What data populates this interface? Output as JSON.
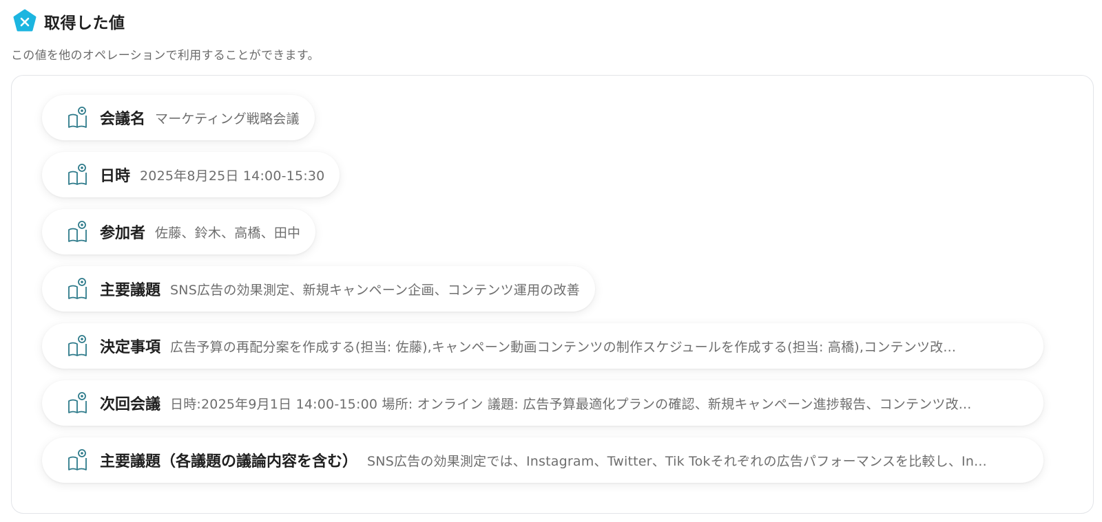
{
  "header": {
    "title": "取得した値",
    "description": "この値を他のオペレーションで利用することができます。",
    "icon": "yoom-logo-icon",
    "accent_color": "#1cb5e0"
  },
  "fields": [
    {
      "label": "会議名",
      "value": "マーケティング戦略会議"
    },
    {
      "label": "日時",
      "value": "2025年8月25日 14:00-15:30"
    },
    {
      "label": "参加者",
      "value": "佐藤、鈴木、高橋、田中"
    },
    {
      "label": "主要議題",
      "value": "SNS広告の効果測定、新規キャンペーン企画、コンテンツ運用の改善"
    },
    {
      "label": "決定事項",
      "value": "広告予算の再配分案を作成する(担当: 佐藤),キャンペーン動画コンテンツの制作スケジュールを作成する(担当: 高橋),コンテンツ改..."
    },
    {
      "label": "次回会議",
      "value": "日時:2025年9月1日 14:00-15:00 場所: オンライン 議題: 広告予算最適化プランの確認、新規キャンペーン進捗報告、コンテンツ改..."
    },
    {
      "label": "主要議題（各議題の議論内容を含む）",
      "value": "SNS広告の効果測定では、Instagram、Twitter、Tik Tokそれぞれの広告パフォーマンスを比較し、In..."
    }
  ],
  "field_icon": "book-view-icon",
  "icon_color": "#2d7a8a"
}
